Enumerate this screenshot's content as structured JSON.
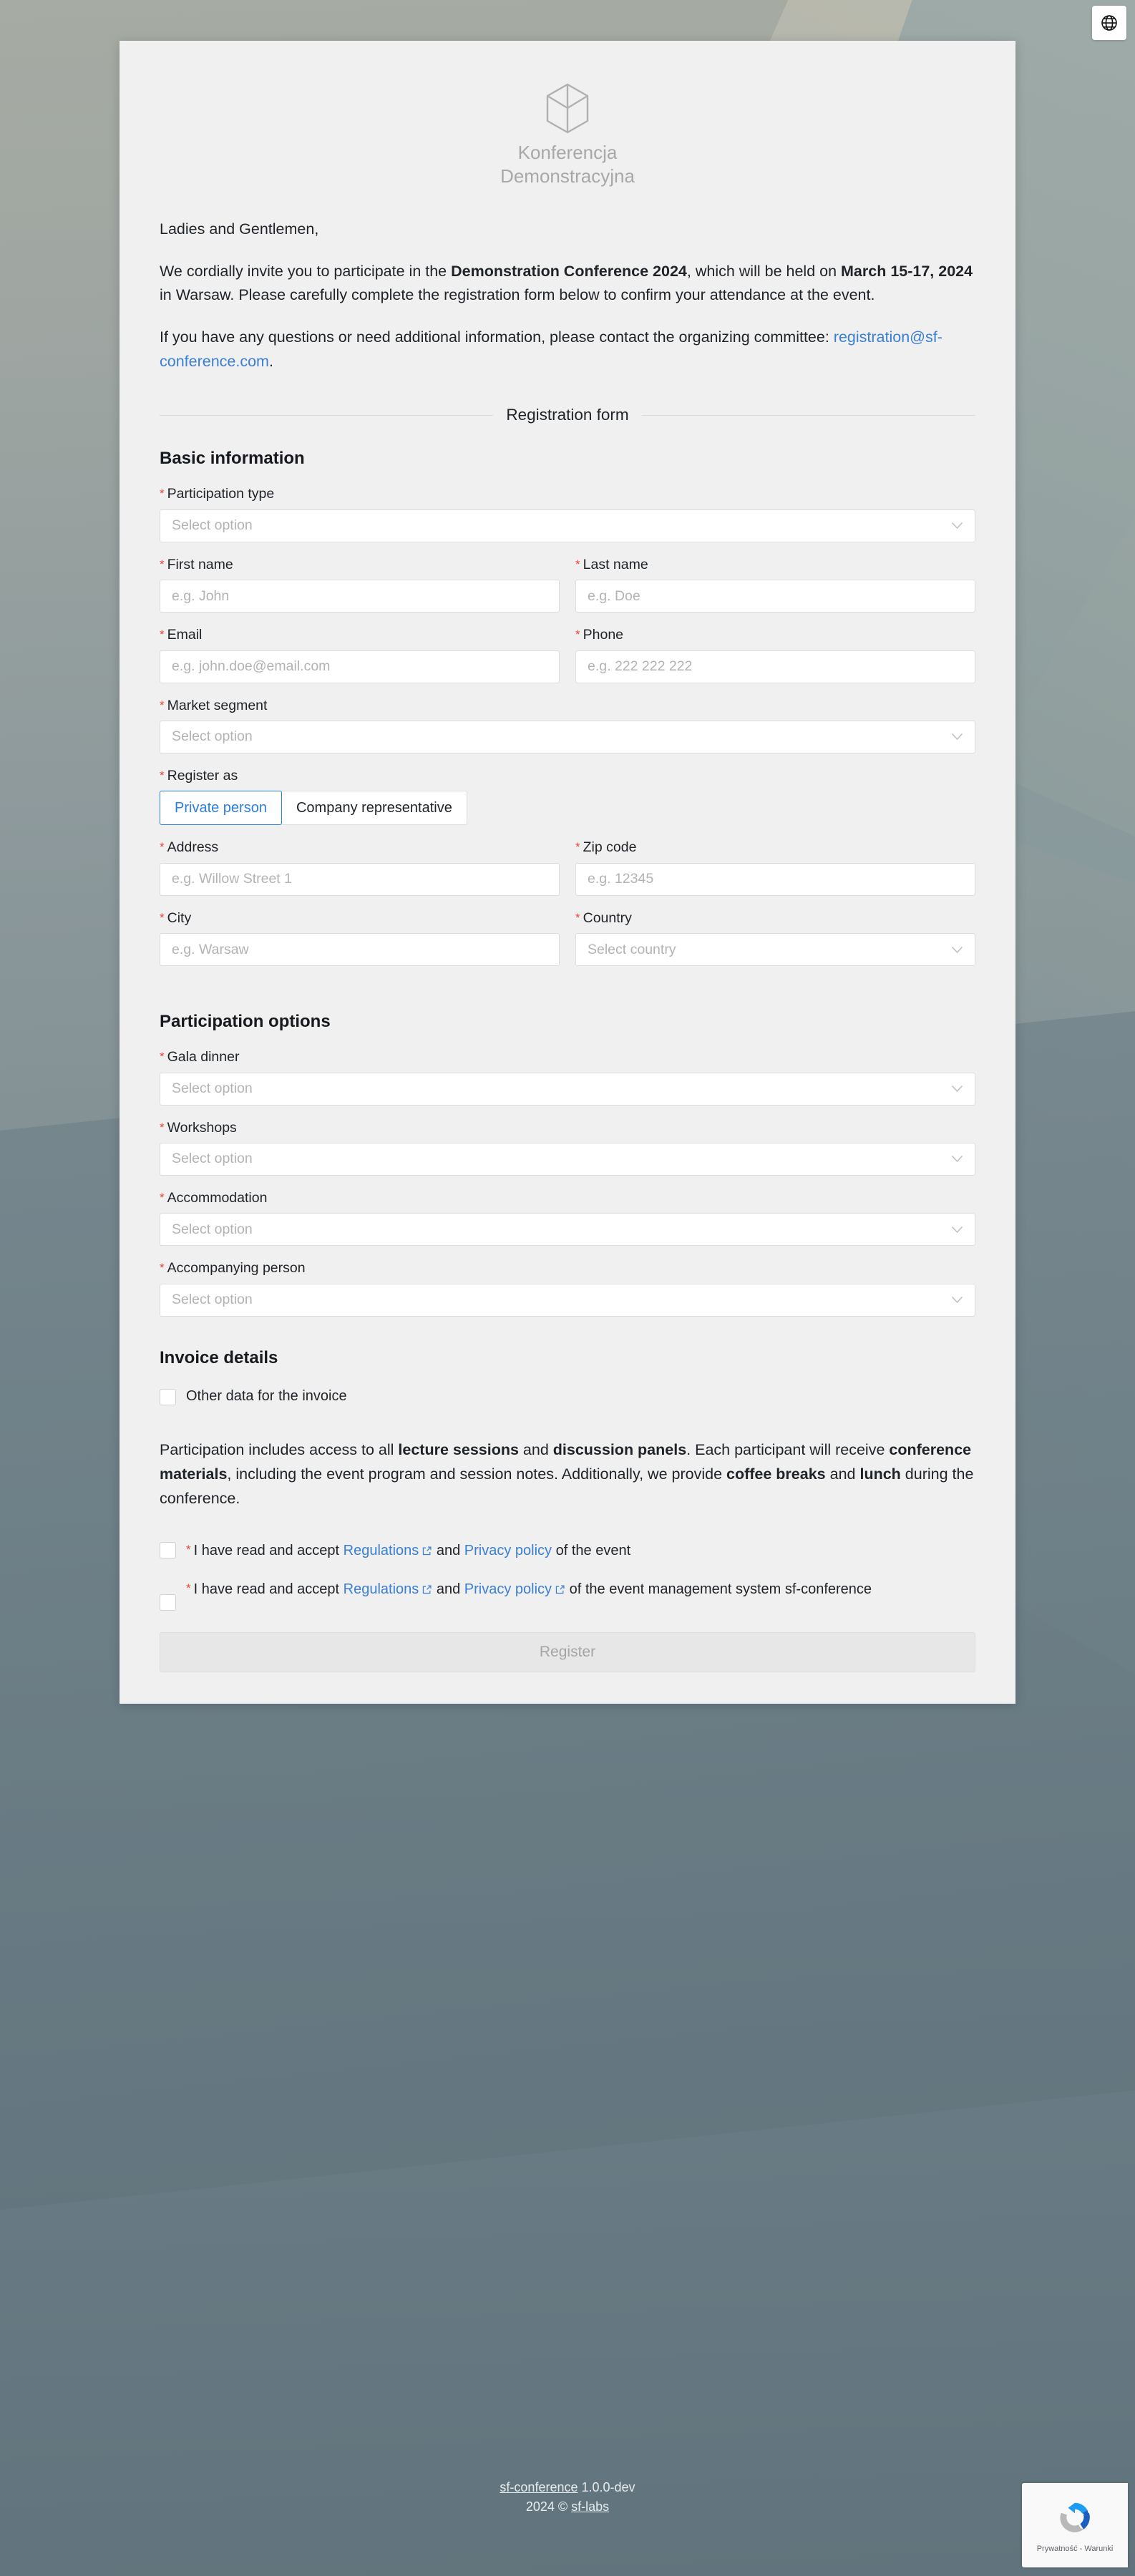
{
  "language_button": {
    "icon": "globe-icon",
    "label": "Language"
  },
  "logo": {
    "icon": "cube-icon",
    "line1": "Konferencja",
    "line2": "Demonstracyjna"
  },
  "intro": {
    "greeting": "Ladies and Gentlemen,",
    "p1_before": "We cordially invite you to participate in the ",
    "p1_bold1": "Demonstration Conference 2024",
    "p1_mid": ", which will be held on ",
    "p1_bold2": "March 15-17, 2024",
    "p1_after": " in Warsaw. Please carefully complete the registration form below to confirm your attendance at the event.",
    "p2_before": "If you have any questions or need additional information, please contact the organizing committee: ",
    "p2_email": "registration@sf-conference.com",
    "p2_after": "."
  },
  "divider": {
    "label": "Registration form"
  },
  "sections": {
    "basic": "Basic information",
    "options": "Participation options",
    "invoice": "Invoice details"
  },
  "fields": {
    "participation_type": {
      "label": "Participation type",
      "placeholder": "Select option",
      "required": true,
      "type": "select"
    },
    "first_name": {
      "label": "First name",
      "placeholder": "e.g. John",
      "required": true,
      "type": "text"
    },
    "last_name": {
      "label": "Last name",
      "placeholder": "e.g. Doe",
      "required": true,
      "type": "text"
    },
    "email": {
      "label": "Email",
      "placeholder": "e.g. john.doe@email.com",
      "required": true,
      "type": "text"
    },
    "phone": {
      "label": "Phone",
      "placeholder": "e.g. 222 222 222",
      "required": true,
      "type": "text"
    },
    "market_segment": {
      "label": "Market segment",
      "placeholder": "Select option",
      "required": true,
      "type": "select"
    },
    "register_as": {
      "label": "Register as",
      "required": true,
      "type": "segmented",
      "options": [
        "Private person",
        "Company representative"
      ],
      "selected": "Private person"
    },
    "address": {
      "label": "Address",
      "placeholder": "e.g. Willow Street 1",
      "required": true,
      "type": "text"
    },
    "zip_code": {
      "label": "Zip code",
      "placeholder": "e.g. 12345",
      "required": true,
      "type": "text"
    },
    "city": {
      "label": "City",
      "placeholder": "e.g. Warsaw",
      "required": true,
      "type": "text"
    },
    "country": {
      "label": "Country",
      "placeholder": "Select country",
      "required": true,
      "type": "select"
    },
    "gala_dinner": {
      "label": "Gala dinner",
      "placeholder": "Select option",
      "required": true,
      "type": "select"
    },
    "workshops": {
      "label": "Workshops",
      "placeholder": "Select option",
      "required": true,
      "type": "select"
    },
    "accommodation": {
      "label": "Accommodation",
      "placeholder": "Select option",
      "required": true,
      "type": "select"
    },
    "accompanying_person": {
      "label": "Accompanying person",
      "placeholder": "Select option",
      "required": true,
      "type": "select"
    }
  },
  "invoice_checkbox": {
    "label": "Other data for the invoice",
    "checked": false
  },
  "notice": {
    "t1": "Participation includes access to all ",
    "b1": "lecture sessions",
    "t2": " and ",
    "b2": "discussion panels",
    "t3": ". Each participant will receive ",
    "b3": "conference materials",
    "t4": ", including the event program and session notes. Additionally, we provide ",
    "b4": "coffee breaks",
    "t5": " and ",
    "b5": "lunch",
    "t6": " during the conference."
  },
  "consents": [
    {
      "checked": false,
      "required": true,
      "t1": "I have read and accept ",
      "link1": "Regulations",
      "link1_external": true,
      "t2": " and ",
      "link2": "Privacy policy",
      "link2_external": false,
      "t3": " of the event"
    },
    {
      "checked": false,
      "required": true,
      "t1": "I have read and accept ",
      "link1": "Regulations",
      "link1_external": true,
      "t2": " and ",
      "link2": "Privacy policy",
      "link2_external": true,
      "t3": " of the event management system sf-conference"
    }
  ],
  "submit": {
    "label": "Register",
    "disabled": true
  },
  "footer": {
    "app_name": "sf-conference",
    "version": "1.0.0-dev",
    "copyright_year": "2024 ©",
    "vendor": "sf-labs"
  },
  "recaptcha": {
    "icon": "recaptcha-icon",
    "text": "Prywatność - Warunki"
  },
  "colors": {
    "accent_blue": "#2b7fe0",
    "link_blue": "#3a7fd5",
    "required_red": "#f04438",
    "card_bg": "#f0f0f0",
    "input_bg": "#ffffff",
    "button_disabled_bg": "#e7e7e7",
    "muted_text": "#b3b3b3"
  }
}
